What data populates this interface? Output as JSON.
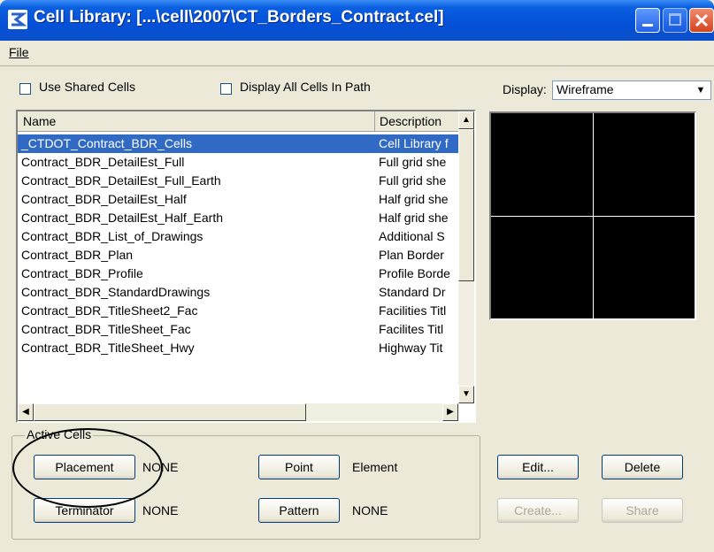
{
  "window": {
    "title": "Cell Library: [...\\cell\\2007\\CT_Borders_Contract.cel]"
  },
  "menu": {
    "file": "File"
  },
  "options": {
    "use_shared_cells": "Use Shared Cells",
    "display_all_cells": "Display All Cells In Path",
    "display_label": "Display:",
    "display_value": "Wireframe"
  },
  "list": {
    "headers": {
      "name": "Name",
      "description": "Description"
    },
    "rows": [
      {
        "name": "_CTDOT_Contract_BDR_Cells",
        "description": "Cell Library f"
      },
      {
        "name": "Contract_BDR_DetailEst_Full",
        "description": "Full grid she"
      },
      {
        "name": "Contract_BDR_DetailEst_Full_Earth",
        "description": "Full grid she"
      },
      {
        "name": "Contract_BDR_DetailEst_Half",
        "description": "Half grid she"
      },
      {
        "name": "Contract_BDR_DetailEst_Half_Earth",
        "description": "Half grid she"
      },
      {
        "name": "Contract_BDR_List_of_Drawings",
        "description": "Additional S"
      },
      {
        "name": "Contract_BDR_Plan",
        "description": "Plan Border"
      },
      {
        "name": "Contract_BDR_Profile",
        "description": "Profile Borde"
      },
      {
        "name": "Contract_BDR_StandardDrawings",
        "description": "Standard Dr"
      },
      {
        "name": "Contract_BDR_TitleSheet2_Fac",
        "description": "Facilities Titl"
      },
      {
        "name": "Contract_BDR_TitleSheet_Fac",
        "description": "Facilites Titl"
      },
      {
        "name": "Contract_BDR_TitleSheet_Hwy",
        "description": "Highway Tit"
      }
    ]
  },
  "active_cells": {
    "group_label": "Active Cells",
    "placement_button": "Placement",
    "placement_value": "NONE",
    "terminator_button": "Terminator",
    "terminator_value": "NONE",
    "point_button": "Point",
    "point_value": "Element",
    "pattern_button": "Pattern",
    "pattern_value": "NONE"
  },
  "actions": {
    "edit": "Edit...",
    "delete": "Delete",
    "create": "Create...",
    "share": "Share"
  },
  "colors": {
    "selection": "#316ac5",
    "titlebar": "#0450d8"
  }
}
